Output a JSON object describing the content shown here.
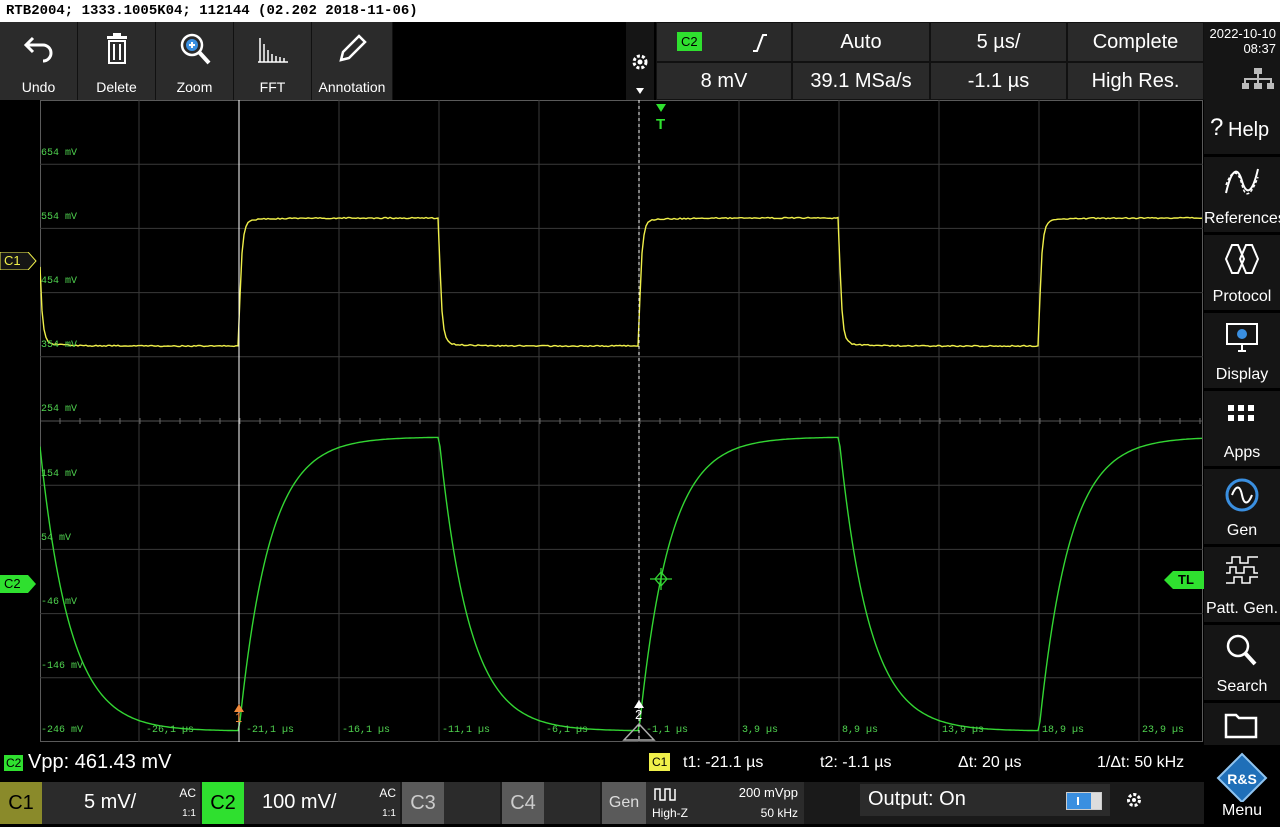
{
  "title": "RTB2004; 1333.1005K04; 112144 (02.202 2018-11-06)",
  "toolbar": {
    "undo": "Undo",
    "delete": "Delete",
    "zoom": "Zoom",
    "fft": "FFT",
    "annotation": "Annotation"
  },
  "header": {
    "channel_badge": "C2",
    "slope_icon": "rising-edge-icon",
    "trigger_mode": "Auto",
    "timebase": "5 µs/",
    "acq_status": "Complete",
    "trigger_level": "8 mV",
    "sample_rate": "39.1 MSa/s",
    "position": "-1.1 µs",
    "acq_mode": "High Res.",
    "date": "2022-10-10",
    "time": "08:37"
  },
  "sidebar": {
    "items": [
      {
        "label": "Help",
        "icon": "help-icon"
      },
      {
        "label": "References",
        "icon": "references-icon"
      },
      {
        "label": "Protocol",
        "icon": "protocol-icon"
      },
      {
        "label": "Display",
        "icon": "display-icon"
      },
      {
        "label": "Apps",
        "icon": "apps-icon"
      },
      {
        "label": "Gen",
        "icon": "generator-icon"
      },
      {
        "label": "Patt. Gen.",
        "icon": "pattern-generator-icon"
      },
      {
        "label": "Search",
        "icon": "search-icon"
      },
      {
        "label": "",
        "icon": "folder-icon"
      },
      {
        "label": "Menu",
        "icon": "rs-logo-icon"
      }
    ]
  },
  "waveform": {
    "c1_marker": "C1",
    "c2_marker": "C2",
    "trigger_marker": "T",
    "trigger_level_marker": "TL",
    "cursor1_label": "1",
    "cursor2_label": "2",
    "y_labels": [
      "654 mV",
      "554 mV",
      "454 mV",
      "354 mV",
      "254 mV",
      "154 mV",
      "54 mV",
      "-46 mV",
      "-146 mV",
      "-246 mV"
    ],
    "x_labels": [
      "-26,1 µs",
      "-21,1 µs",
      "-16,1 µs",
      "-11,1 µs",
      "-6,1 µs",
      "-1,1 µs",
      "3,9 µs",
      "8,9 µs",
      "13,9 µs",
      "18,9 µs",
      "23,9 µs"
    ],
    "c1_color": "#f0f04a",
    "c2_color": "#33d633",
    "period_us": 20,
    "c1_high_mV": 554,
    "c1_low_mV": 354
  },
  "measurements": {
    "vpp_badge": "C2",
    "vpp": "Vpp: 461.43 mV",
    "cursor_badge": "C1",
    "t1": "t1: -21.1 µs",
    "t2": "t2: -1.1 µs",
    "dt": "Δt: 20 µs",
    "inv_dt": "1/Δt: 50 kHz"
  },
  "channels": {
    "c1": {
      "name": "C1",
      "scale": "5 mV/",
      "coupling": "AC",
      "probe": "1:1"
    },
    "c2": {
      "name": "C2",
      "scale": "100 mV/",
      "coupling": "AC",
      "probe": "1:1"
    },
    "c3": {
      "name": "C3"
    },
    "c4": {
      "name": "C4"
    },
    "gen": {
      "name": "Gen",
      "amp": "200 mVpp",
      "load": "High-Z",
      "freq": "50 kHz"
    },
    "output": "Output: On"
  }
}
